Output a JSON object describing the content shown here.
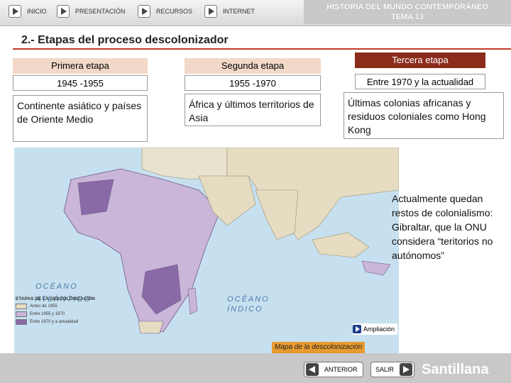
{
  "nav": {
    "inicio": "INICIO",
    "presentacion": "PRESENTACIÓN",
    "recursos": "RECURSOS",
    "internet": "INTERNET"
  },
  "header": {
    "title_line1": "HISTORIA DEL MUNDO CONTEMPORÁNEO",
    "title_line2": "TEMA 13"
  },
  "section_title": "2.- Etapas del proceso descolonizador",
  "stages": [
    {
      "name": "Primera etapa",
      "dates": "1945 -1955",
      "description": "Continente asiático y países de Oriente Medio"
    },
    {
      "name": "Segunda etapa",
      "dates": "1955 -1970",
      "description": "África y últimos territorios de Asia"
    },
    {
      "name": "Tercera etapa",
      "dates": "Entre 1970 y la actualidad",
      "description": "Últimas colonias africanas y residuos coloniales como Hong Kong"
    }
  ],
  "map": {
    "legend_title": "ETAPAS DE LA DESCOLONIZACIÓN",
    "legend": [
      {
        "label": "Antes de 1955",
        "color": "#e6dcc2"
      },
      {
        "label": "Entre 1955 y 1970",
        "color": "#c9b6d8"
      },
      {
        "label": "Entre 1970 y a actualidad",
        "color": "#8a6aa6"
      }
    ],
    "oceans": [
      "OCÉANO",
      "ATLÁNTICO",
      "OCÉANO",
      "ÍNDICO"
    ],
    "caption": "Mapa de la descolonización"
  },
  "note": "Actualmente quedan restos de colonialismo: Gibraltar, que la ONU considera “teritorios no autónomos”",
  "ampliacion": "Ampliación",
  "footer": {
    "anterior": "ANTERIOR",
    "salir": "SALIR",
    "brand": "Santillana"
  }
}
